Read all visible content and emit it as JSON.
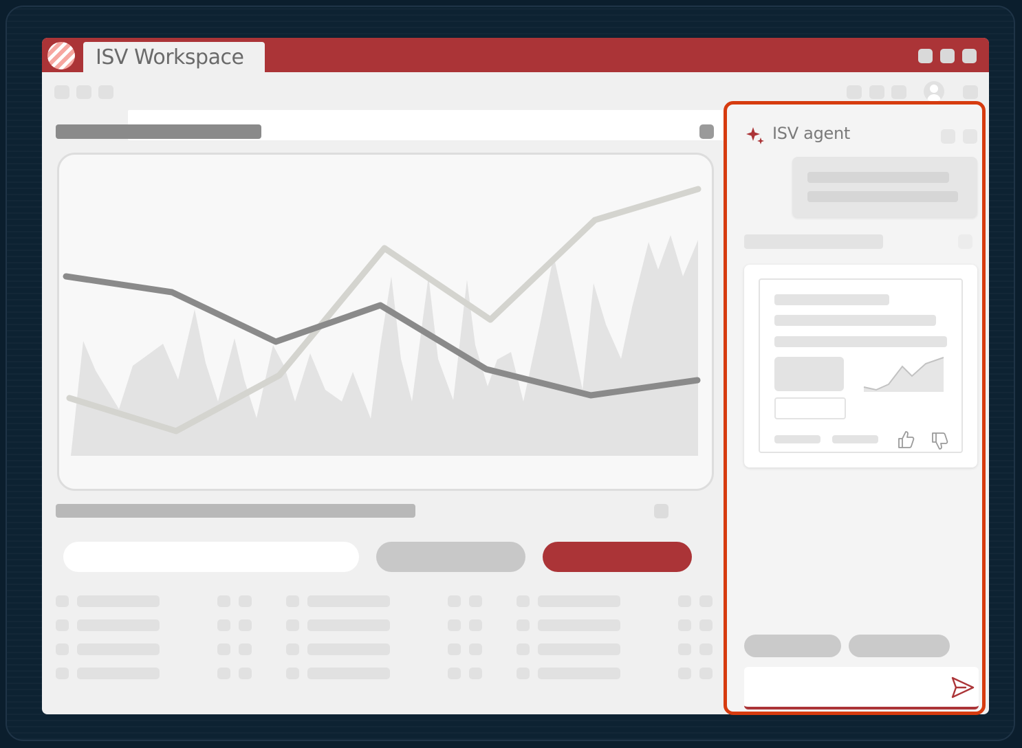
{
  "app": {
    "window_title": "ISV Workspace"
  },
  "agent": {
    "title": "ISV agent"
  },
  "icons": {
    "logo": "striped-logo-icon",
    "sparkle": "sparkle-icon",
    "send": "send-icon",
    "thumbs_up": "thumbs-up-icon",
    "thumbs_down": "thumbs-down-icon",
    "avatar": "user-avatar-icon"
  },
  "colors": {
    "brand": "#ab3437",
    "highlight_border": "#d63b0f",
    "background": "#0b1e2d"
  }
}
